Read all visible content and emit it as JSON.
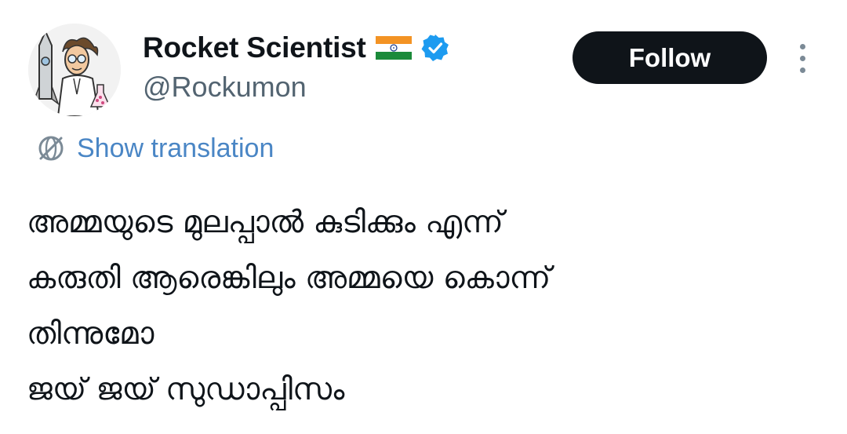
{
  "author": {
    "display_name": "Rocket Scientist",
    "handle": "@Rockumon",
    "avatar_icon": "scientist-rocket-avatar",
    "flag_icon": "india-flag-icon",
    "verified_icon": "verified-badge-icon",
    "verified_color": "#1d9bf0"
  },
  "actions": {
    "follow_label": "Follow",
    "more_icon": "more-vertical-icon"
  },
  "translation": {
    "label": "Show translation",
    "icon": "translate-globe-icon",
    "color": "#4a86c5"
  },
  "tweet": {
    "lines": [
      "അമ്മയുടെ മുലപ്പാൽ കുടിക്കും എന്ന്",
      "കരുതി ആരെങ്കിലും അമ്മയെ കൊന്ന്",
      "തിന്നുമോ",
      "ജയ് ജയ് സുഡാപ്പിസം"
    ]
  }
}
